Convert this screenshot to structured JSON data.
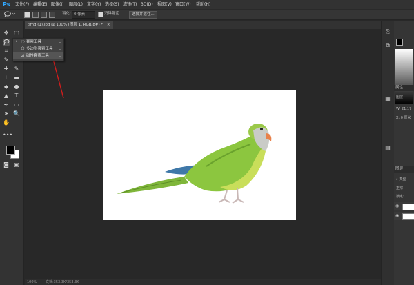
{
  "app": {
    "logo": "Ps",
    "menu": [
      "文件(F)",
      "编辑(E)",
      "图像(I)",
      "图层(L)",
      "文字(Y)",
      "选择(S)",
      "滤镜(T)",
      "3D(D)",
      "视图(V)",
      "窗口(W)",
      "帮助(H)"
    ]
  },
  "options": {
    "feather_label": "羽化:",
    "feather_value": "0 像素",
    "antialias_label": "消除锯齿",
    "select_mask_button": "选择并遮住..."
  },
  "document": {
    "tab_title": "timg (1).jpg @ 100% (图层 1, RGB/8#) *",
    "close": "×",
    "zoom": "100%",
    "doc_info": "文档:353.3K/353.3K"
  },
  "flyout": {
    "items": [
      {
        "icon": "lasso-icon",
        "label": "套索工具",
        "shortcut": "L",
        "active": true
      },
      {
        "icon": "polygonal-lasso-icon",
        "label": "多边形套索工具",
        "shortcut": "L",
        "active": false
      },
      {
        "icon": "magnetic-lasso-icon",
        "label": "磁性套索工具",
        "shortcut": "L",
        "active": false
      }
    ]
  },
  "panels": {
    "properties_tab": "属性",
    "properties_icon_label": "图层",
    "w_label": "W:",
    "w_value": "21.17",
    "x_label": "X:",
    "x_value": "0 厘米",
    "layers_tab": "图层",
    "filter_kind": "类型",
    "blend_mode": "正常",
    "lock_label": "锁定:"
  },
  "colors": {
    "accent": "#31a8ff",
    "annotation_arrow": "#d11d1d",
    "foreground": "#000000",
    "background": "#ffffff"
  }
}
